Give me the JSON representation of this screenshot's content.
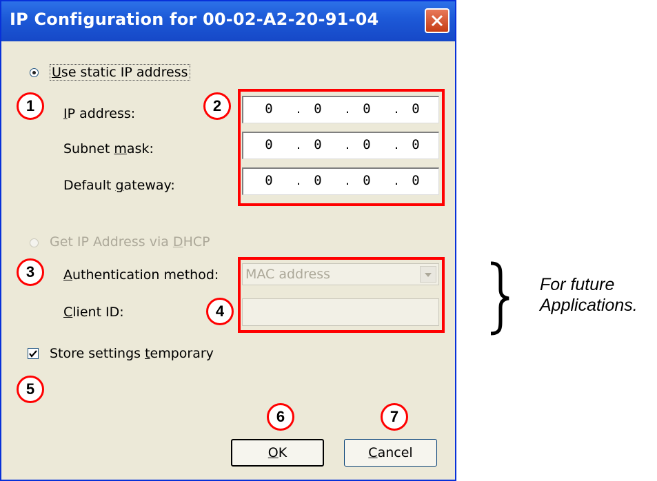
{
  "dialog": {
    "title": "IP Configuration for  00-02-A2-20-91-04",
    "static_radio": {
      "label_pre": "",
      "label_u": "U",
      "label_post": "se static IP address",
      "checked": true
    },
    "fields": [
      {
        "label_pre": "",
        "label_u": "I",
        "label_post": "P address:",
        "octets": [
          "0",
          "0",
          "0",
          "0"
        ]
      },
      {
        "label_pre": "Subnet ",
        "label_u": "m",
        "label_post": "ask:",
        "octets": [
          "0",
          "0",
          "0",
          "0"
        ]
      },
      {
        "label_pre": "Default ",
        "label_u": "g",
        "label_post": "ateway:",
        "octets": [
          "0",
          "0",
          "0",
          "0"
        ]
      }
    ],
    "dhcp_radio": {
      "label_pre": "Get IP Address via ",
      "label_u": "D",
      "label_post": "HCP",
      "checked": false,
      "enabled": false
    },
    "auth": {
      "label_pre": "",
      "label_u": "A",
      "label_post": "uthentication method:",
      "value": "MAC address"
    },
    "client_id": {
      "label_pre": "",
      "label_u": "C",
      "label_post": "lient ID:",
      "value": ""
    },
    "store_checkbox": {
      "label_pre": "Store settings ",
      "label_u": "t",
      "label_post": "emporary",
      "checked": true
    },
    "ok_button": {
      "label_u": "O",
      "label_post": "K"
    },
    "cancel_button": {
      "label_u": "C",
      "label_post": "ancel"
    }
  },
  "callouts": [
    "1",
    "2",
    "3",
    "4",
    "5",
    "6",
    "7"
  ],
  "annotation": {
    "line1": "For future",
    "line2": "Applications."
  },
  "colors": {
    "titlebar": "#1d5ad8",
    "highlight": "#ff0000",
    "dialog_bg": "#ece9d8"
  }
}
